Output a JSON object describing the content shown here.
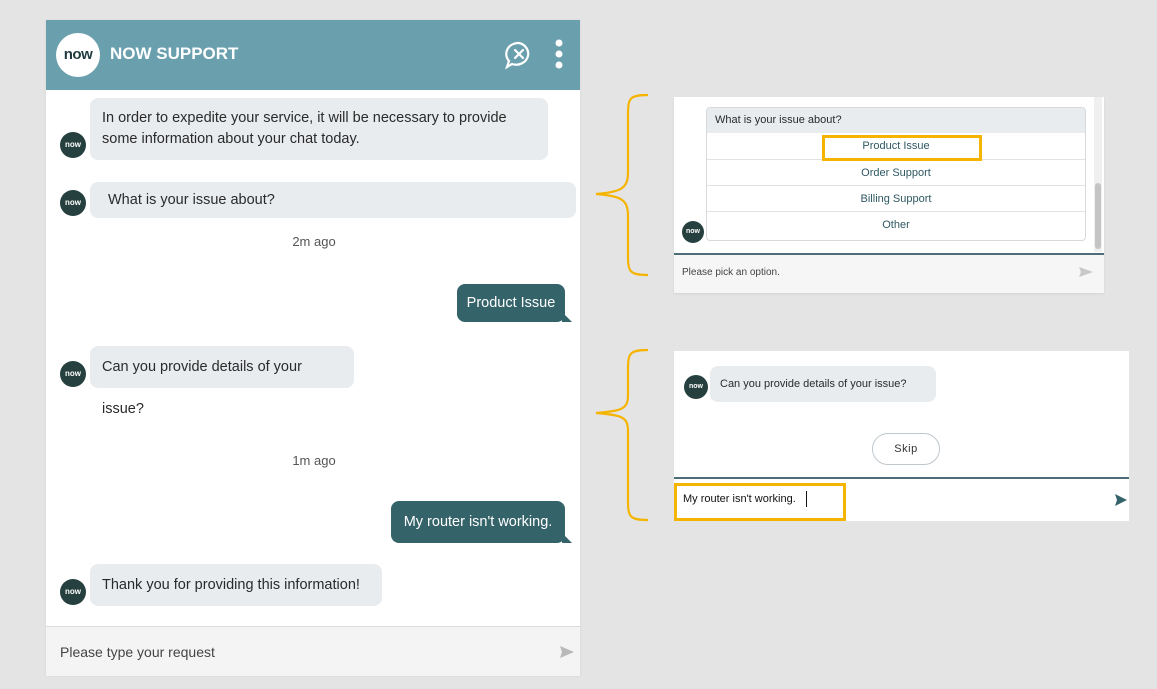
{
  "chat": {
    "logo_text": "now",
    "title": "NOW SUPPORT",
    "avatar_text": "now",
    "messages": {
      "intro": "In order to expedite your service, it will be necessary to provide some information about your chat today.",
      "question": "What is your issue about?",
      "reply1": "Product Issue",
      "details": "Can you provide details of your issue?",
      "reply2": "My router isn't working.",
      "thanks": "Thank you for providing this information!"
    },
    "timestamps": [
      "2m ago",
      "1m ago"
    ],
    "input_placeholder": "Please type your request",
    "header_icons": [
      "close-chat-icon",
      "more-options-icon"
    ]
  },
  "option_panel": {
    "question": "What is your issue about?",
    "options": [
      "Product Issue",
      "Order Support",
      "Billing Support",
      "Other"
    ],
    "highlighted_option": "Product Issue",
    "input_placeholder": "Please pick an option."
  },
  "details_panel": {
    "question": "Can you provide details of your issue?",
    "skip_label": "Skip",
    "input_value": "My router isn't working."
  },
  "colors": {
    "header": "#6a9fae",
    "outgoing_bubble": "#35636a",
    "incoming_bubble": "#e9ecef",
    "highlight": "#f5b400",
    "avatar": "#26403f"
  }
}
